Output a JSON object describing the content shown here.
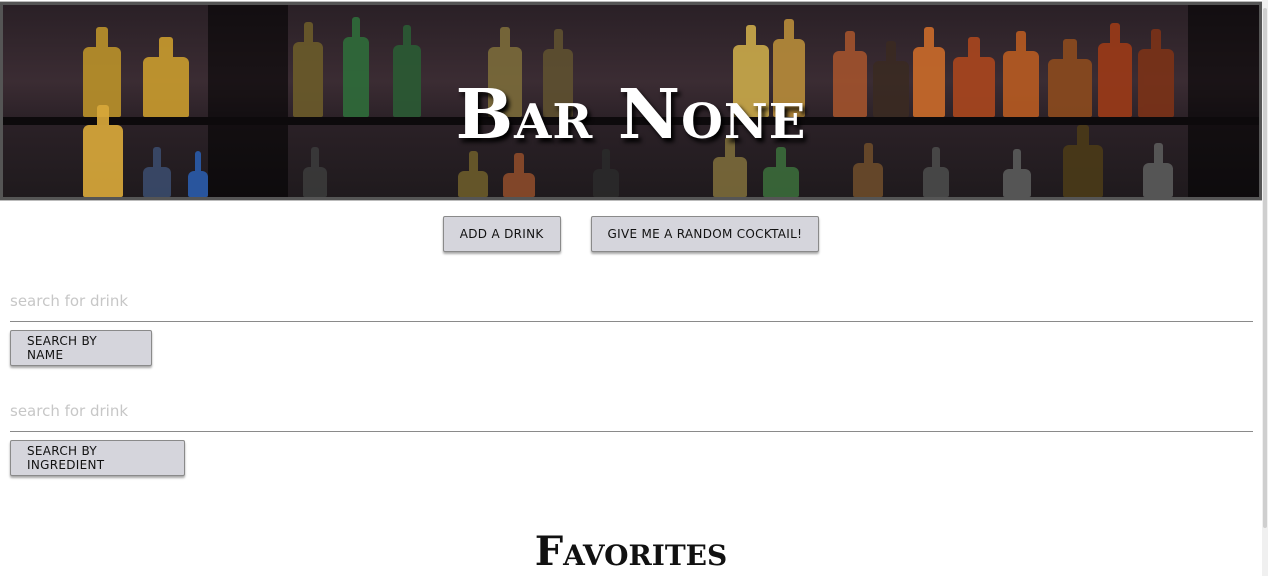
{
  "header": {
    "title": "Bar None"
  },
  "actions": {
    "add_drink_label": "Add a Drink",
    "random_cocktail_label": "Give me a random cocktail!"
  },
  "search_name": {
    "placeholder": "search for drink",
    "value": "",
    "button_label": "Search by Name"
  },
  "search_ingredient": {
    "placeholder": "search for drink",
    "value": "",
    "button_label": "Search by Ingredient"
  },
  "favorites": {
    "title": "Favorites"
  }
}
